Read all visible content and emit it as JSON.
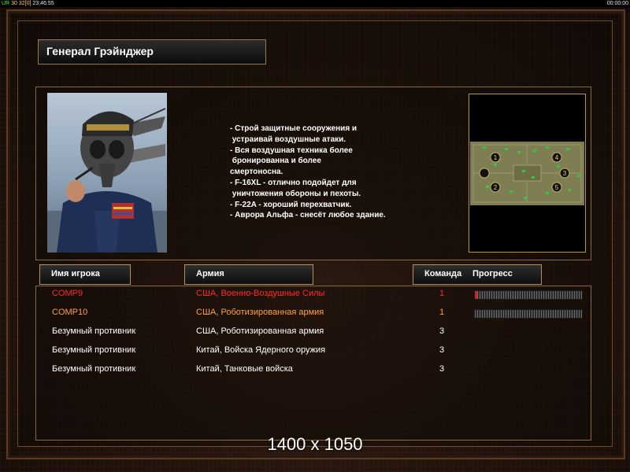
{
  "status_bar": {
    "left_a": "UR",
    "left_b": "30",
    "left_c": "32",
    "left_d": "[0]",
    "left_time": "23:46:55",
    "right_time": "00:00:00"
  },
  "general": {
    "name": "Генерал Грэйнджер",
    "description_lines": [
      "- Строй защитные сооружения и",
      " устраивай воздушные атаки.",
      "- Вся воздушная техника более",
      " бронированна и более",
      "смертоносна.",
      "- F-16XL - отлично подойдет для",
      " уничтожения обороны и пехоты.",
      "- F-22A - хороший перехватчик.",
      "- Аврора Альфа - снесёт любое здание."
    ]
  },
  "map": {
    "slots": [
      "1",
      "2",
      "3",
      "4",
      "5"
    ]
  },
  "columns": {
    "player_name": "Имя игрока",
    "army": "Армия",
    "team": "Команда",
    "progress": "Прогресс"
  },
  "players": [
    {
      "name": "COMP9",
      "army": "США, Военно-Воздушные Силы",
      "team": "1",
      "color": "#ff2a2a",
      "progress": 0.02
    },
    {
      "name": "COMP10",
      "army": "США, Роботизированная армия",
      "team": "1",
      "color": "#ffa040",
      "progress": 0.0
    },
    {
      "name": "Безумный противник",
      "army": "США, Роботизированная армия",
      "team": "3",
      "color": "#ffffff"
    },
    {
      "name": "Безумный противник",
      "army": "Китай, Войска Ядерного оружия",
      "team": "3",
      "color": "#ffffff"
    },
    {
      "name": "Безумный противник",
      "army": "Китай, Танковые войска",
      "team": "3",
      "color": "#ffffff"
    }
  ],
  "watermark": "1400 x 1050"
}
